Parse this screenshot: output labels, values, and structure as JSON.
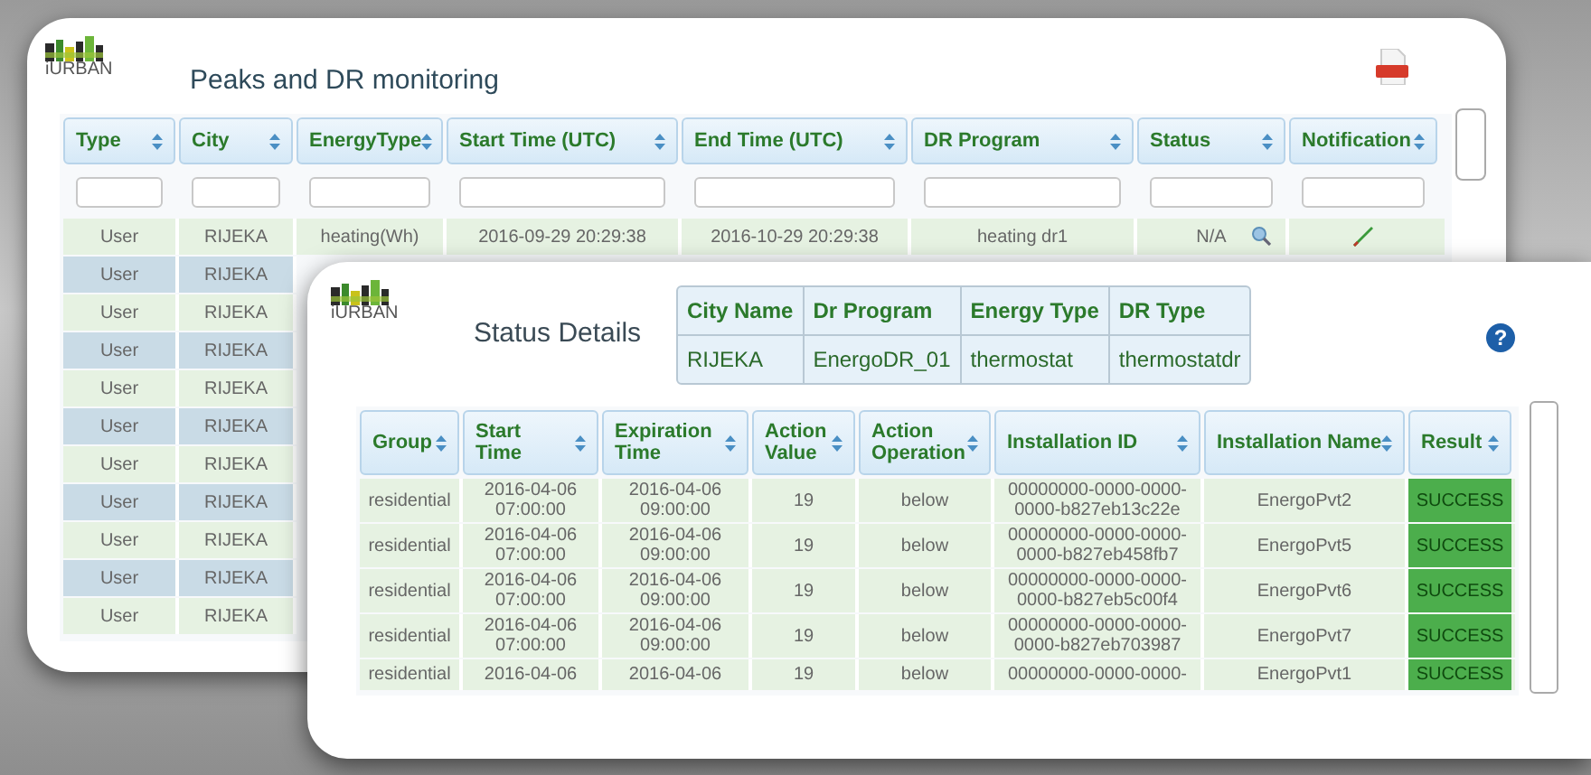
{
  "monitor": {
    "logo_text": "iURBAN",
    "title": "Peaks and DR monitoring",
    "columns": [
      "Type",
      "City",
      "EnergyType",
      "Start Time (UTC)",
      "End Time (UTC)",
      "DR Program",
      "Status",
      "Notification"
    ],
    "rows": [
      {
        "type": "User",
        "city": "RIJEKA",
        "energy_type": "heating(Wh)",
        "start_time": "2016-09-29 20:29:38",
        "end_time": "2016-10-29 20:29:38",
        "dr_program": "heating dr1",
        "status": "N/A"
      },
      {
        "type": "User",
        "city": "RIJEKA"
      },
      {
        "type": "User",
        "city": "RIJEKA"
      },
      {
        "type": "User",
        "city": "RIJEKA"
      },
      {
        "type": "User",
        "city": "RIJEKA"
      },
      {
        "type": "User",
        "city": "RIJEKA"
      },
      {
        "type": "User",
        "city": "RIJEKA"
      },
      {
        "type": "User",
        "city": "RIJEKA"
      },
      {
        "type": "User",
        "city": "RIJEKA"
      },
      {
        "type": "User",
        "city": "RIJEKA"
      },
      {
        "type": "User",
        "city": "RIJEKA"
      }
    ]
  },
  "details": {
    "logo_text": "iURBAN",
    "title": "Status Details",
    "help_label": "?",
    "info": {
      "columns": [
        "City Name",
        "Dr Program",
        "Energy Type",
        "DR Type"
      ],
      "values": [
        "RIJEKA",
        "EnergoDR_01",
        "thermostat",
        "thermostatdr"
      ]
    },
    "columns": [
      "Group",
      "Start\nTime",
      "Expiration\nTime",
      "Action\nValue",
      "Action\nOperation",
      "Installation ID",
      "Installation Name",
      "Result"
    ],
    "rows": [
      {
        "group": "residential",
        "start_time": "2016-04-06\n07:00:00",
        "expiration_time": "2016-04-06\n09:00:00",
        "action_value": "19",
        "action_operation": "below",
        "installation_id": "00000000-0000-0000-\n0000-b827eb13c22e",
        "installation_name": "EnergoPvt2",
        "result": "SUCCESS"
      },
      {
        "group": "residential",
        "start_time": "2016-04-06\n07:00:00",
        "expiration_time": "2016-04-06\n09:00:00",
        "action_value": "19",
        "action_operation": "below",
        "installation_id": "00000000-0000-0000-\n0000-b827eb458fb7",
        "installation_name": "EnergoPvt5",
        "result": "SUCCESS"
      },
      {
        "group": "residential",
        "start_time": "2016-04-06\n07:00:00",
        "expiration_time": "2016-04-06\n09:00:00",
        "action_value": "19",
        "action_operation": "below",
        "installation_id": "00000000-0000-0000-\n0000-b827eb5c00f4",
        "installation_name": "EnergoPvt6",
        "result": "SUCCESS"
      },
      {
        "group": "residential",
        "start_time": "2016-04-06\n07:00:00",
        "expiration_time": "2016-04-06\n09:00:00",
        "action_value": "19",
        "action_operation": "below",
        "installation_id": "00000000-0000-0000-\n0000-b827eb703987",
        "installation_name": "EnergoPvt7",
        "result": "SUCCESS"
      },
      {
        "group": "residential",
        "start_time": "2016-04-06",
        "expiration_time": "2016-04-06",
        "action_value": "19",
        "action_operation": "below",
        "installation_id": "00000000-0000-0000-",
        "installation_name": "EnergoPvt1",
        "result": "SUCCESS"
      }
    ]
  }
}
